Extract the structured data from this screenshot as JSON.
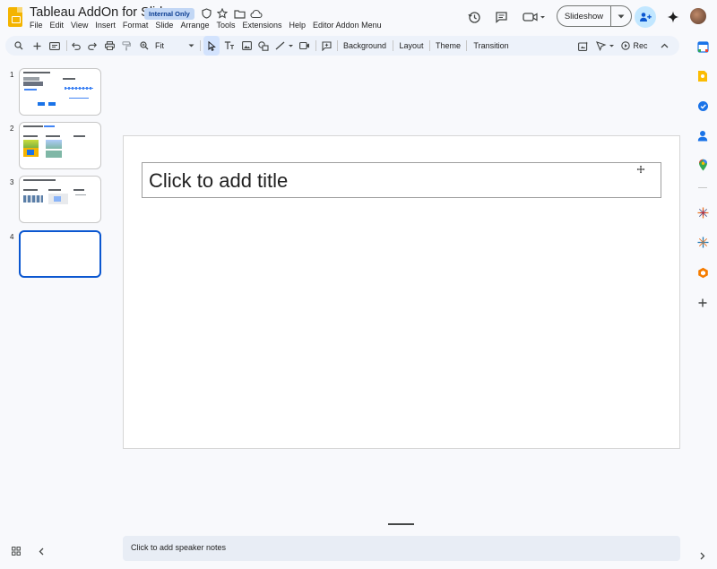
{
  "app": {
    "title": "Tableau AddOn for Slides",
    "badge": "Internal Only",
    "menu": [
      "File",
      "Edit",
      "View",
      "Insert",
      "Format",
      "Slide",
      "Arrange",
      "Tools",
      "Extensions",
      "Help",
      "Editor Addon Menu"
    ],
    "slideshow_label": "Slideshow"
  },
  "toolbar": {
    "zoom": "Fit",
    "background": "Background",
    "layout": "Layout",
    "theme": "Theme",
    "transition": "Transition",
    "rec": "Rec"
  },
  "filmstrip": {
    "slides": [
      {
        "number": "1"
      },
      {
        "number": "2"
      },
      {
        "number": "3"
      },
      {
        "number": "4"
      }
    ],
    "selected": 4
  },
  "slide": {
    "title_placeholder": "Click to add title"
  },
  "notes": {
    "placeholder": "Click to add speaker notes"
  },
  "colors": {
    "accent": "#0b57d0",
    "brand_slides": "#f4b400",
    "badge_bg": "#c2d7f5",
    "share_bg": "#c2e7ff"
  }
}
